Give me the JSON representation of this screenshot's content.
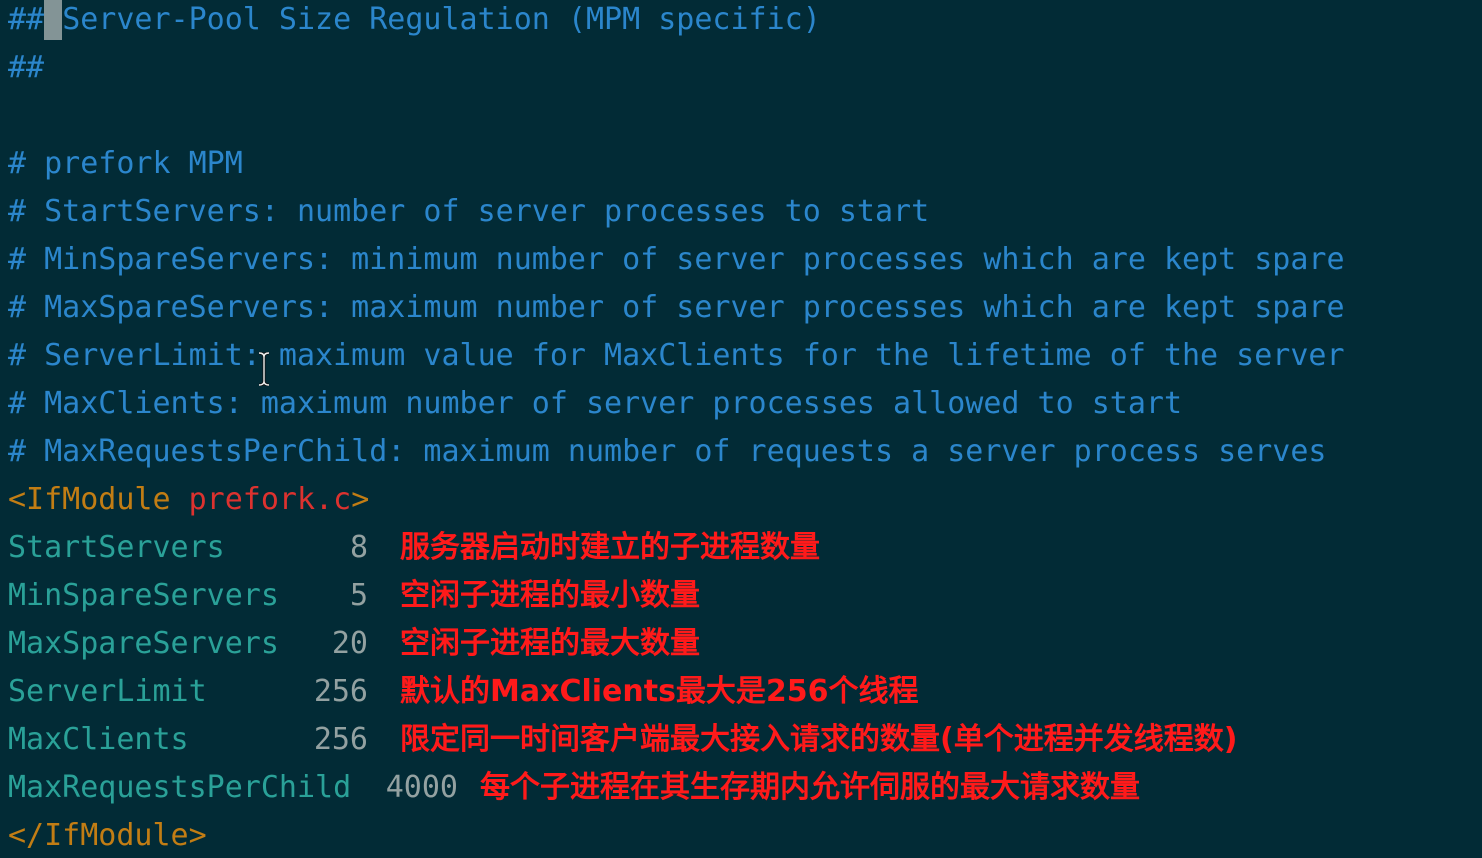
{
  "editor": {
    "lines": {
      "l1_prefix": "## ",
      "l1_text": "Server-Pool Size Regulation (MPM specific)",
      "l2": "##",
      "l4": "# prefork MPM",
      "l5": "# StartServers: number of server processes to start",
      "l6": "# MinSpareServers: minimum number of server processes which are kept spare",
      "l7": "# MaxSpareServers: maximum number of server processes which are kept spare",
      "l8": "# ServerLimit: maximum value for MaxClients for the lifetime of the server",
      "l9": "# MaxClients: maximum number of server processes allowed to start",
      "l10": "# MaxRequestsPerChild: maximum number of requests a server process serves",
      "ifmodule_open": "<IfModule ",
      "ifmodule_arg": "prefork.c",
      "ifmodule_close_bracket": ">",
      "ifmodule_end": "</IfModule>"
    },
    "directives": [
      {
        "name": "StartServers",
        "value": "8",
        "annotation": "服务器启动时建立的子进程数量"
      },
      {
        "name": "MinSpareServers",
        "value": "5",
        "annotation": "空闲子进程的最小数量"
      },
      {
        "name": "MaxSpareServers",
        "value": "20",
        "annotation": "空闲子进程的最大数量"
      },
      {
        "name": "ServerLimit",
        "value": "256",
        "annotation": "默认的MaxClients最大是256个线程"
      },
      {
        "name": "MaxClients",
        "value": "256",
        "annotation": "限定同一时间客户端最大接入请求的数量(单个进程并发线程数)"
      },
      {
        "name": "MaxRequestsPerChild",
        "value": "4000",
        "annotation": "每个子进程在其生存期内允许伺服的最大请求数量"
      }
    ]
  },
  "colors": {
    "background": "#022b36",
    "comment": "#2b86cc",
    "tag": "#c27d14",
    "tag_arg": "#dc322f",
    "directive": "#2aa198",
    "annotation": "#ff1a1a"
  },
  "icons": {
    "cursor": "text-cursor-ibeam-icon"
  }
}
